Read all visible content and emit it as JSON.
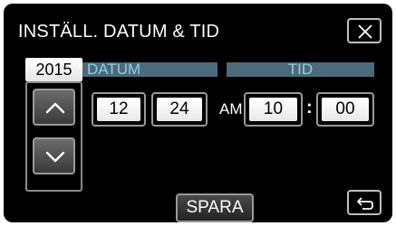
{
  "header": {
    "title": "INSTÄLL. DATUM & TID"
  },
  "icons": {
    "close": "close-icon",
    "back": "return-icon",
    "up": "chevron-up-icon",
    "down": "chevron-down-icon"
  },
  "date": {
    "label": "DATUM",
    "year": "2015",
    "month": "12",
    "day": "24"
  },
  "time": {
    "label": "TID",
    "ampm": "AM",
    "hour": "10",
    "separator": ":",
    "minute": "00"
  },
  "footer": {
    "save_label": "SPARA"
  },
  "colors": {
    "background": "#000000",
    "header_bar": "#4d6a7a",
    "header_text": "#8fd0ea",
    "field_bg": "#ffffff",
    "border": "#9a9a9a"
  }
}
